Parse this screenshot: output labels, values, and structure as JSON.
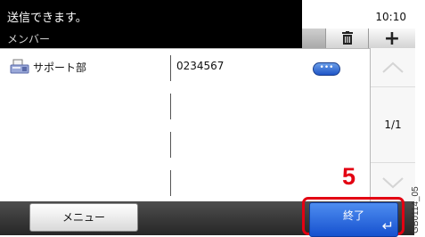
{
  "status": {
    "message": "送信できます。",
    "time": "10:10"
  },
  "header": {
    "title": "メンバー",
    "delete_icon": "trash-icon",
    "add_label": "+"
  },
  "members": [
    {
      "name": "サポート部",
      "number": "0234567",
      "detail_label": "•••",
      "icon": "fax-icon"
    },
    {
      "name": "",
      "number": ""
    },
    {
      "name": "",
      "number": ""
    },
    {
      "name": "",
      "number": ""
    }
  ],
  "pagination": {
    "label": "1/1"
  },
  "footer": {
    "menu_label": "メニュー",
    "end_label": "終了",
    "enter_icon": "enter-arrow-icon"
  },
  "annotation": {
    "step": "5",
    "figure_code": "GB0114_05"
  },
  "colors": {
    "highlight": "#e30012",
    "accent_blue": "#1f55c7"
  }
}
